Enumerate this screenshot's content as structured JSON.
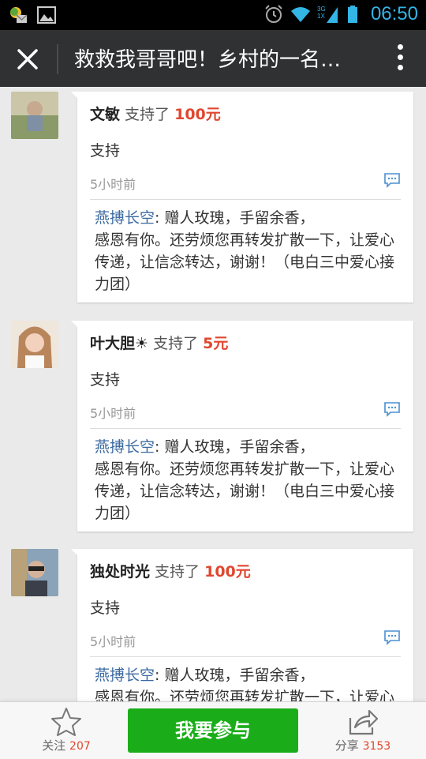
{
  "status_bar": {
    "time": "06:50",
    "network": "3G",
    "network_sub": "1X",
    "icons": [
      "weather-mail-icon",
      "gallery-icon",
      "alarm-icon",
      "wifi-icon",
      "signal-icon",
      "battery-icon"
    ]
  },
  "navbar": {
    "title": "救救我哥哥吧！乡村的一名…",
    "close_icon": "close-icon",
    "more_icon": "more-vert-icon"
  },
  "supporters": [
    {
      "name": "文敏",
      "action": " 支持了 ",
      "amount": "100元",
      "message": "支持",
      "time": "5小时前",
      "reply_name": "燕搏长空",
      "reply_text": ": 赠人玫瑰，手留余香，\n感恩有你。还劳烦您再转发扩散一下，让爱心传递，让信念转达，谢谢！（电白三中爱心接力团）"
    },
    {
      "name": "叶大胆☀",
      "action": " 支持了 ",
      "amount": "5元",
      "message": "支持",
      "time": "5小时前",
      "reply_name": "燕搏长空",
      "reply_text": ": 赠人玫瑰，手留余香，\n感恩有你。还劳烦您再转发扩散一下，让爱心传递，让信念转达，谢谢！（电白三中爱心接力团）"
    },
    {
      "name": "独处时光",
      "action": " 支持了 ",
      "amount": "100元",
      "message": "支持",
      "time": "5小时前",
      "reply_name": "燕搏长空",
      "reply_text": ": 赠人玫瑰，手留余香，\n感恩有你。还劳烦您再转发扩散一下，让爱心传递，让信念转达，谢谢！（电白三中爱心接力团）"
    }
  ],
  "bottom_bar": {
    "follow_label": "关注",
    "follow_count": "207",
    "join_label": "我要参与",
    "share_label": "分享",
    "share_count": "3153"
  },
  "colors": {
    "accent_green": "#1aad19",
    "amount_red": "#e0472f",
    "reply_name_blue": "#3b6aa0",
    "navbar_bg": "#2f3133",
    "status_blue": "#33b5e5"
  }
}
